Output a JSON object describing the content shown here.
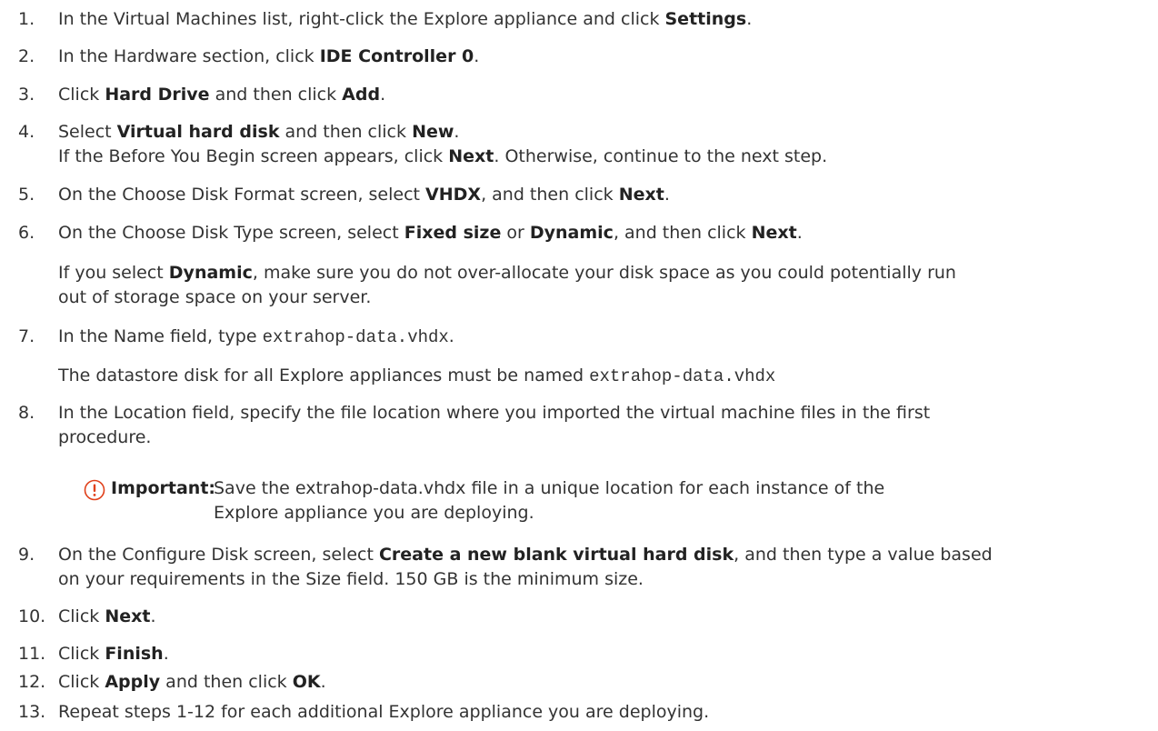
{
  "steps": [
    {
      "num": "1.",
      "pre": "In the Virtual Machines list, right-click the Explore appliance and click ",
      "b1": "Settings",
      "post": "."
    },
    {
      "num": "2.",
      "pre": "In the Hardware section, click ",
      "b1": "IDE Controller 0",
      "post": "."
    },
    {
      "num": "3.",
      "pre": "Click ",
      "b1": "Hard Drive",
      "mid": " and then click ",
      "b2": "Add",
      "post": "."
    },
    {
      "num": "4.",
      "pre": "Select ",
      "b1": "Virtual hard disk",
      "mid": " and then click ",
      "b2": "New",
      "post": ".",
      "sub_pre": "If the Before You Begin screen appears, click ",
      "sub_b": "Next",
      "sub_post": ". Otherwise, continue to the next step."
    },
    {
      "num": "5.",
      "pre": "On the Choose Disk Format screen, select ",
      "b1": "VHDX",
      "mid": ", and then click ",
      "b2": "Next",
      "post": "."
    },
    {
      "num": "6.",
      "pre": "On the Choose Disk Type screen, select ",
      "b1": "Fixed size",
      "mid": " or ",
      "b2": "Dynamic",
      "mid2": ", and then click ",
      "b3": "Next",
      "post": ".",
      "note_pre": "If you select ",
      "note_b": "Dynamic",
      "note_post": ", make sure you do not over-allocate your disk space as you could potentially run",
      "note_line2": "out of storage space on your server."
    },
    {
      "num": "7.",
      "pre": "In the Name field, type ",
      "code": "extrahop-data.vhdx",
      "post": ".",
      "note_pre": "The datastore disk for all Explore appliances must be named ",
      "note_code": "extrahop-data.vhdx"
    },
    {
      "num": "8.",
      "line1": "In the Location field, specify the file location where you imported the virtual machine files in the first",
      "line2": "procedure."
    },
    {
      "num": "9.",
      "pre": "On the Configure Disk screen, select ",
      "b1": "Create a new blank virtual hard disk",
      "post": ", and then type a value based",
      "line2": "on your requirements in the Size field. 150 GB is the minimum size."
    },
    {
      "num": "10.",
      "pre": "Click ",
      "b1": "Next",
      "post": "."
    },
    {
      "num": "11.",
      "pre": "Click ",
      "b1": "Finish",
      "post": "."
    },
    {
      "num": "12.",
      "pre": "Click ",
      "b1": "Apply",
      "mid": " and then click ",
      "b2": "OK",
      "post": "."
    },
    {
      "num": "13.",
      "line1": "Repeat steps 1-12 for each additional Explore appliance you are deploying."
    }
  ],
  "important": {
    "label": "Important:",
    "line1": "Save the extrahop-data.vhdx file in a unique location for each instance of the",
    "line2": "Explore appliance you are deploying."
  },
  "colors": {
    "text": "#333333",
    "icon_stroke": "#e0401a"
  }
}
